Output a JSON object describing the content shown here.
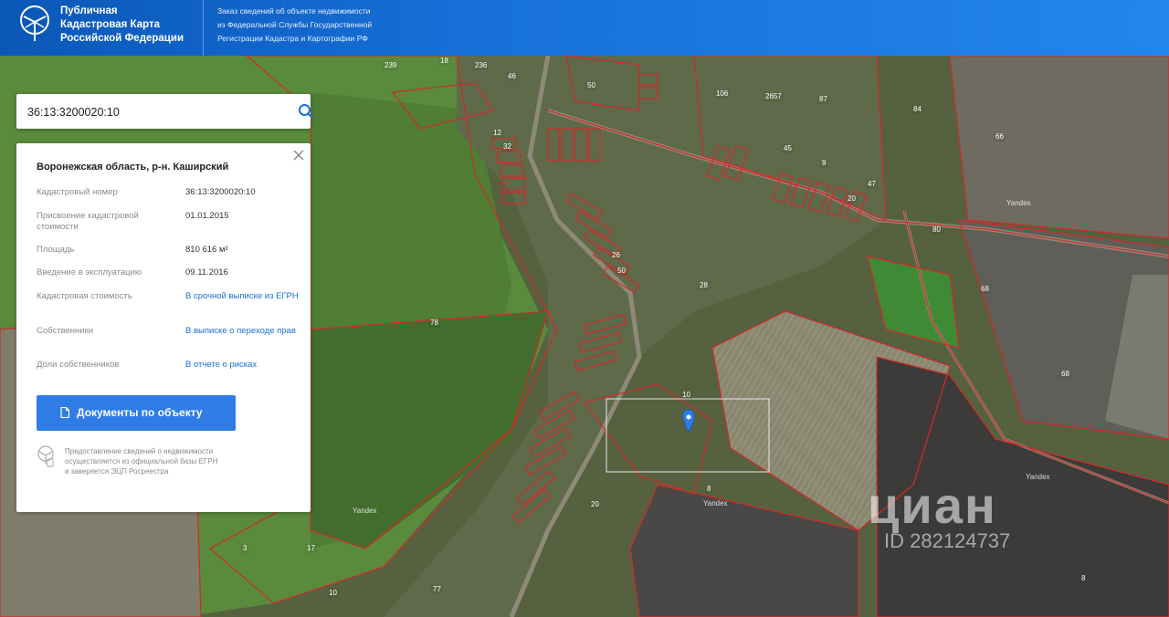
{
  "header": {
    "brand_line1": "Публичная",
    "brand_line2": "Кадастровая Карта",
    "brand_line3": "Российской Федерации",
    "note_line1": "Заказ сведений об объекте недвижимости",
    "note_line2": "из Федеральной Службы Государственной",
    "note_line3": "Регистрации Кадастра и Картографии РФ"
  },
  "search": {
    "value": "36:13:3200020:10",
    "icon": "search-icon"
  },
  "card": {
    "region": "Воронежская область, р-н. Каширский",
    "rows": [
      {
        "key": "Кадастровый номер",
        "value": "36:13:3200020:10"
      },
      {
        "key": "Присвоение кадастровой стоимости",
        "value": "01.01.2015"
      },
      {
        "key": "Площадь",
        "value": "810 616 м²"
      },
      {
        "key": "Введение в эксплуатацию",
        "value": "09.11.2016"
      },
      {
        "key": "Кадастровая стоимость",
        "value": "В срочной выписке из ЕГРН"
      },
      {
        "key": "Собственники",
        "value": "В выписке о переходе прав"
      },
      {
        "key": "Доли собственников",
        "value": "В отчете о рисках"
      }
    ],
    "docs_button": "Документы по объекту",
    "note_line1": "Предоставление сведений о недвижимости",
    "note_line2": "осуществляется из официальной базы ЕГРН",
    "note_line3": "и заверяется ЭЦП Росреестра"
  },
  "map": {
    "plot_labels": [
      "239",
      "18",
      "236",
      "46",
      "50",
      "106",
      "2657",
      "87",
      "84",
      "66",
      "12",
      "32",
      "45",
      "9",
      "20",
      "47",
      "80",
      "26",
      "50",
      "28",
      "78",
      "68",
      "10",
      "68",
      "8",
      "8",
      "20",
      "3",
      "17",
      "10",
      "77"
    ],
    "yandex": [
      "Yandex",
      "Yandex",
      "Yandex",
      "Yandex"
    ],
    "watermark_brand": "циан",
    "watermark_id": "ID 282124737"
  },
  "colors": {
    "header": "#1670d8",
    "boundary": "#d42a2a",
    "button": "#2f7de4",
    "marker": "#2f7de4"
  }
}
